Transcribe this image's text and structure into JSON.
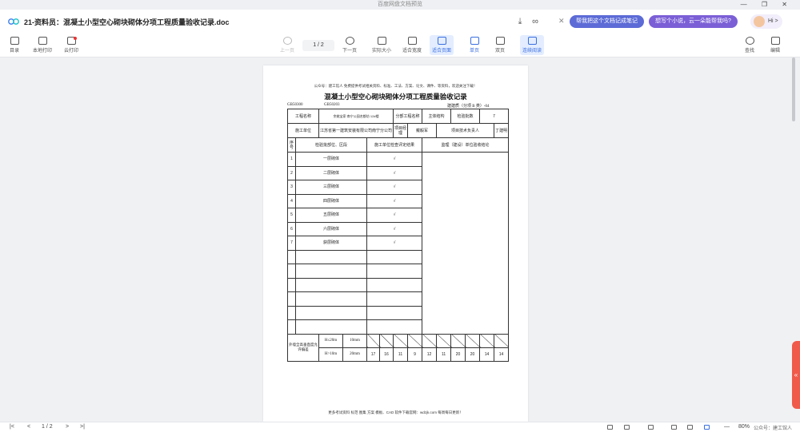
{
  "system": {
    "app_name": "百度网盘文档预览",
    "window_controls": "— ❐ ✕"
  },
  "titlebar": {
    "doc_title": "21-资料员：混凝土小型空心砌块砌体分项工程质量验收记录.doc",
    "ai_suggestions": [
      "帮我把这个文档记成笔记",
      "想写个小说，云一朵能帮我吗?"
    ],
    "assistant_label": "Hi >"
  },
  "toolbar": {
    "left": [
      {
        "label": "目录"
      },
      {
        "label": "本地打印"
      },
      {
        "label": "云打印"
      }
    ],
    "prev_label": "上一页",
    "page_indicator": "1 / 2",
    "next_label": "下一页",
    "view": [
      {
        "label": "实际大小"
      },
      {
        "label": "适合宽度"
      },
      {
        "label": "适合页面"
      },
      {
        "label": "单页"
      },
      {
        "label": "双页"
      },
      {
        "label": "连续阅读"
      }
    ],
    "right": [
      {
        "label": "查找"
      },
      {
        "label": "编辑"
      }
    ]
  },
  "document": {
    "header_note": "公众号：建工馆人 免费提供考试相关资料、标准、工法、方案、论文、课件、等资料，欢迎关注下载！",
    "title": "混凝土小型空心砌块砌体分项工程质量验收记录",
    "standard_left": "GB50300",
    "standard_mid": "GB50203",
    "table_code": "建建质（分项 B 类）-04",
    "project_name_label": "工程名称",
    "project_name": "余姚宝家·南宁公园名都坊 12#楼",
    "subsection_label": "分部工程名称",
    "subsection": "主体结构",
    "batch_count_label": "检验批数",
    "batch_count": "7",
    "contractor_label": "施工单位",
    "contractor": "江苏省第一建筑安装有限公司南宁分公司",
    "manager_label": "项目经理",
    "manager": "戴毅军",
    "tech_lead_label": "项目技术负责人",
    "tech_lead": "丁建明",
    "col_no": "序号",
    "col_part": "检验批部位、区段",
    "col_result": "施工单位检查评定结果",
    "col_supervision": "监理（建设）单位验收结论",
    "rows": [
      {
        "no": "1",
        "part": "一层砌体",
        "result": "√"
      },
      {
        "no": "2",
        "part": "二层砌体",
        "result": "√"
      },
      {
        "no": "3",
        "part": "三层砌体",
        "result": "√"
      },
      {
        "no": "4",
        "part": "四层砌体",
        "result": "√"
      },
      {
        "no": "5",
        "part": "五层砌体",
        "result": "√"
      },
      {
        "no": "6",
        "part": "六层砌体",
        "result": "√"
      },
      {
        "no": "7",
        "part": "获层砌体",
        "result": "√"
      }
    ],
    "verticality_label": "外墙全高垂直度允许偏差",
    "vert_row1": {
      "cond": "H≤20m",
      "limit": "10mm"
    },
    "vert_row2": {
      "cond": "H>10m",
      "limit": "20mm",
      "values": [
        "17",
        "16",
        "11",
        "9",
        "12",
        "11",
        "20",
        "20",
        "14",
        "14"
      ]
    },
    "footer_note": "更多考试资料  标范  图集  方案  模板、CAD 软件下载官网：wdzjk.com  每周每日更新！"
  },
  "statusbar": {
    "page": "1 / 2",
    "zoom": "80%",
    "watermark": "公众号：建工馆人"
  }
}
